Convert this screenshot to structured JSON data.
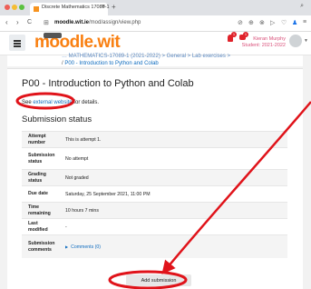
{
  "browser": {
    "tab_title": "Discrete Mathematics 17089-1",
    "tab_close": "×",
    "new_tab": "+",
    "url_host": "moodle.wit.ie",
    "url_path": "/mod/assign/view.php",
    "nav_back": "‹",
    "nav_forward": "›",
    "nav_reload": "C",
    "home": "⊞"
  },
  "header": {
    "logo": "moodle.wit",
    "user_name": "Kieran Murphy",
    "user_role": "Student: 2021-2022",
    "bell_count": "1",
    "chat_count": "1"
  },
  "breadcrumb": {
    "path_partial": "… MATHEMATICS-17089-1 (2021-2022) > General > Lab exercises >",
    "current": "P00 - Introduction to Python and Colab"
  },
  "assignment": {
    "title": "P00 - Introduction to Python and Colab",
    "see_prefix": "See ",
    "see_link": "external website",
    "see_suffix": " for details.",
    "status_title": "Submission status"
  },
  "status_table": [
    {
      "label": "Attempt number",
      "value": "This is attempt 1."
    },
    {
      "label": "Submission status",
      "value": "No attempt"
    },
    {
      "label": "Grading status",
      "value": "Not graded"
    },
    {
      "label": "Due date",
      "value": "Saturday, 25 September 2021, 11:00 PM"
    },
    {
      "label": "Time remaining",
      "value": "10 hours 7 mins"
    },
    {
      "label": "Last modified",
      "value": "-"
    },
    {
      "label": "Submission comments",
      "value": "Comments (0)"
    }
  ],
  "actions": {
    "add_submission": "Add submission"
  },
  "colors": {
    "moodle_orange": "#f98012",
    "annotation_red": "#e0131a",
    "link_blue": "#0f6cbf"
  }
}
